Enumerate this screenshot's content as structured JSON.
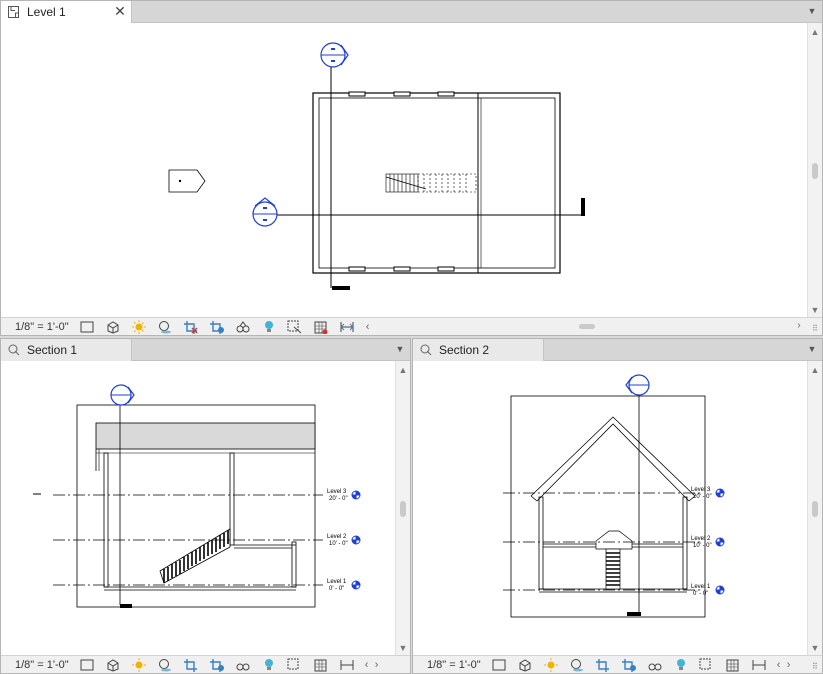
{
  "panes": {
    "top": {
      "tab_label": "Level 1",
      "close_symbol": "✕",
      "scale": "1/8\" = 1'-0\""
    },
    "bottom_left": {
      "tab_label": "Section 1",
      "scale": "1/8\" = 1'-0\"",
      "levels": [
        {
          "name": "Level 3",
          "elev": "20' - 0\""
        },
        {
          "name": "Level 2",
          "elev": "10' - 0\""
        },
        {
          "name": "Level 1",
          "elev": "0' - 0\""
        }
      ]
    },
    "bottom_right": {
      "tab_label": "Section 2",
      "scale": "1/8\" = 1'-0\"",
      "levels": [
        {
          "name": "Level 3",
          "elev": "20' - 0\""
        },
        {
          "name": "Level 2",
          "elev": "10' - 0\""
        },
        {
          "name": "Level 1",
          "elev": "0' - 0\""
        }
      ]
    }
  },
  "colors": {
    "marker_blue": "#1f3fd6",
    "roof_gray": "#d9d9d9"
  },
  "status_icons": [
    "visual-style-icon",
    "detail-level-icon",
    "sun-path-icon",
    "shadows-icon",
    "crop-view-icon",
    "show-crop-icon",
    "temporary-hide-icon",
    "reveal-hidden-icon",
    "lightbulb-icon",
    "worksharing-icon",
    "display-model-icon",
    "analytical-model-icon"
  ]
}
